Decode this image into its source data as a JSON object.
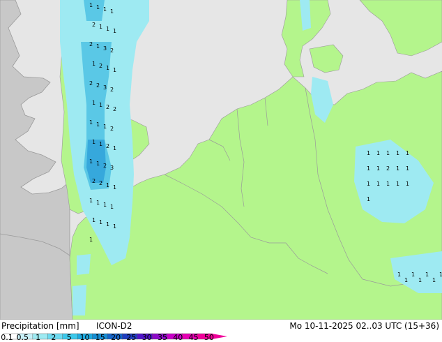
{
  "colors": {
    "sea": "#e6e6e6",
    "land_forecast": "#b4f58c",
    "land_outside": "#c8c8c8",
    "border": "#9a9a9a",
    "rain_light": "#9eeaf2",
    "rain_mid": "#5ac8e6",
    "rain_heavy": "#36a8dc",
    "value_text": "#000000"
  },
  "legend": {
    "title": "Precipitation [mm]",
    "model": "ICON-D2",
    "datetime": "Mo 10-11-2025 02..03 UTC (15+36)",
    "ticks": [
      "0.1",
      "0.5",
      "1",
      "2",
      "5",
      "10",
      "15",
      "20",
      "25",
      "30",
      "35",
      "40",
      "45",
      "50"
    ],
    "swatch_colors": [
      "#ffffff",
      "#c8f0f8",
      "#9eeaf2",
      "#6edaf0",
      "#3cc8ea",
      "#1eaae0",
      "#148cd2",
      "#1464c8",
      "#1e3cbe",
      "#5014c8",
      "#8c0ac8",
      "#c800c8",
      "#e600b4",
      "#f0009a"
    ]
  },
  "precip_labels": {
    "band_values": [
      "1",
      "1",
      "1",
      "1",
      "2",
      "1",
      "1",
      "1",
      "2",
      "1",
      "3",
      "2",
      "1",
      "2",
      "1",
      "1",
      "2",
      "2",
      "3",
      "2",
      "1",
      "1",
      "2",
      "2",
      "1",
      "1",
      "1",
      "2",
      "1",
      "1",
      "2",
      "1",
      "1",
      "1",
      "2",
      "3",
      "2",
      "2",
      "1",
      "1",
      "1",
      "1",
      "1",
      "1",
      "1",
      "1",
      "1",
      "1",
      "1"
    ],
    "east_values": [
      "1",
      "1",
      "1",
      "1",
      "1",
      "1",
      "1",
      "2",
      "1",
      "1",
      "1",
      "1",
      "1",
      "1",
      "1",
      "1",
      "1",
      "1",
      "1",
      "1",
      "1",
      "1",
      "1"
    ]
  }
}
